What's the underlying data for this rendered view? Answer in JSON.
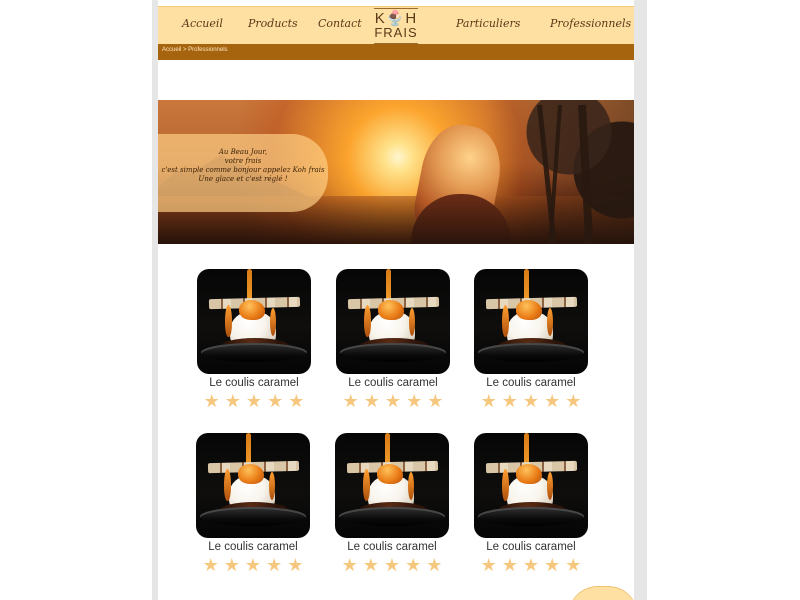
{
  "nav": {
    "items": [
      {
        "label": "Accueil"
      },
      {
        "label": "Products"
      },
      {
        "label": "Contact"
      },
      {
        "label": "Particuliers"
      },
      {
        "label": "Professionnels"
      }
    ],
    "logo": {
      "top_text": "K🍨H",
      "bottom_text": "FRAIS"
    }
  },
  "breadcrumb": {
    "text": "Accueil > Professionnels"
  },
  "hero": {
    "lines": [
      "Au Beau Jour,",
      "votre frais",
      "c'est simple comme bonjour appelez Koh frais",
      "Une glace et c'est réglé !"
    ]
  },
  "products": [
    {
      "title": "Le coulis caramel",
      "rating": 5
    },
    {
      "title": "Le coulis caramel",
      "rating": 5
    },
    {
      "title": "Le coulis caramel",
      "rating": 5
    },
    {
      "title": "Le coulis caramel",
      "rating": 5
    },
    {
      "title": "Le coulis caramel",
      "rating": 5
    },
    {
      "title": "Le coulis caramel",
      "rating": 5
    }
  ],
  "icons": {
    "star": "star-icon",
    "logo": "ice-cream-logo-icon"
  },
  "colors": {
    "nav_background": "#fde0a2",
    "breadcrumb_background": "#a6640f",
    "star": "#f6c77e"
  }
}
